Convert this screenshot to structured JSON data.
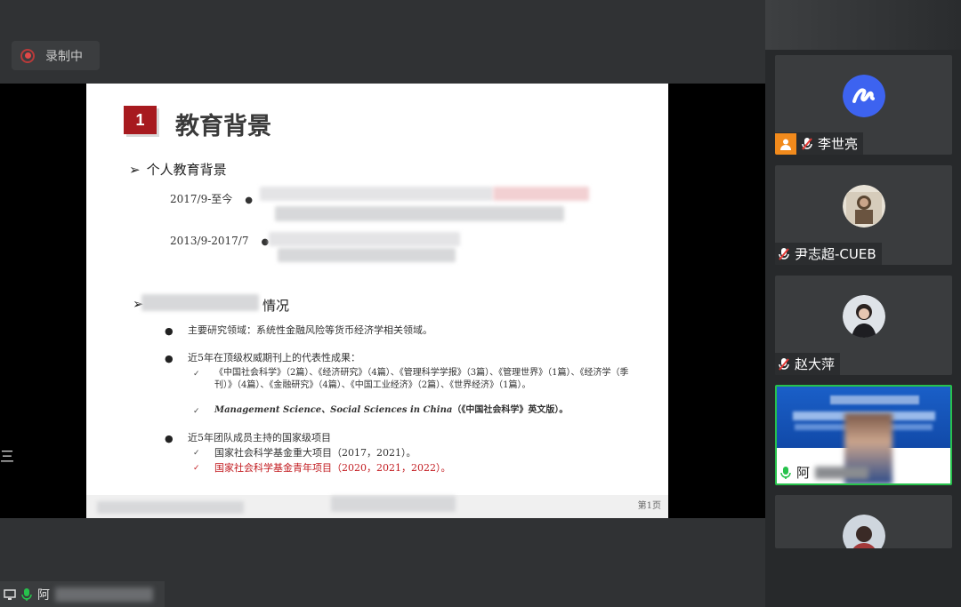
{
  "recording": {
    "label": "录制中"
  },
  "slide": {
    "section_number": "1",
    "title": "教育背景",
    "heading1": "个人教育背景",
    "edu": [
      {
        "period": "2017/9-至今"
      },
      {
        "period": "2013/9-2017/7"
      }
    ],
    "heading2_visible": "情况",
    "research": "主要研究领域：系统性金融风险等货币经济学相关领域。",
    "papers_intro": "近5年在顶级权威期刊上的代表性成果：",
    "papers_line1": "《中国社会科学》（2篇）、《经济研究》（4篇）、《管理科学学报》（3篇）、《管理世界》（1篇）、《经济学（季刊）》（4篇）、《金融研究》（4篇）、《中国工业经济》（2篇）、《世界经济》（1篇）。",
    "papers_line2_italic": "Management Science、Social Sciences in China",
    "papers_line2_tail": "（《中国社会科学》英文版）。",
    "projects_intro": "近5年团队成员主持的国家级项目",
    "project1": "国家社会科学基金重大项目（2017，2021）。",
    "project2": "国家社会科学基金青年项目（2020，2021，2022）。",
    "page_label": "第1页"
  },
  "left_edge_glyph": "三",
  "participants": [
    {
      "name": "李世亮",
      "role": "host",
      "avatar": "app-logo-icon"
    },
    {
      "name": "尹志超-CUEB",
      "avatar": "photo-avatar"
    },
    {
      "name": "赵大萍",
      "avatar": "photo-avatar"
    },
    {
      "name": "阿",
      "active": true
    },
    {
      "name": ""
    }
  ],
  "bottom_tile": {
    "name": "阿"
  },
  "colors": {
    "accent_red": "#a71a1f",
    "active_border": "#27c24c",
    "host_orange": "#f18a1c"
  }
}
